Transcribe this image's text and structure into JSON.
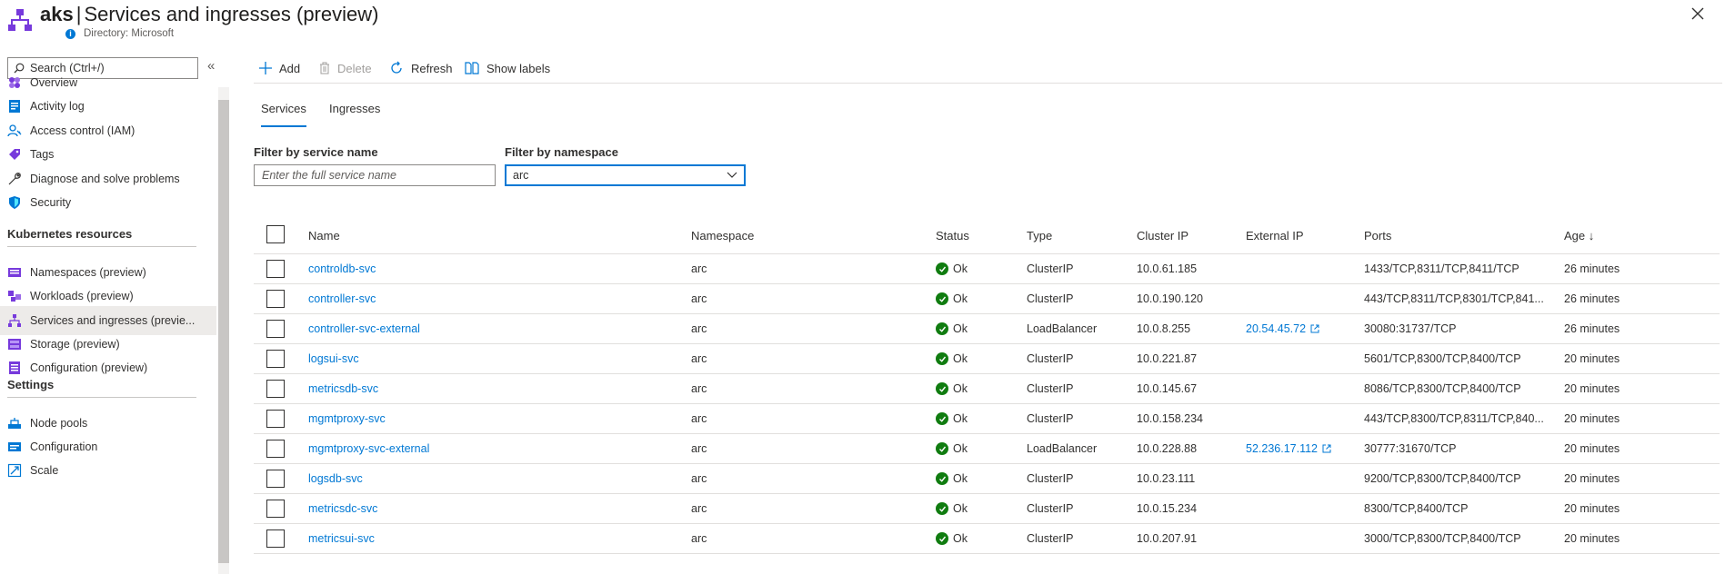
{
  "header": {
    "resource_name": "aks",
    "separator": "|",
    "page_title": "Services and ingresses (preview)",
    "directory": "Directory: Microsoft",
    "info_icon": "info-icon",
    "close_icon": "close-icon"
  },
  "sidebar": {
    "search_placeholder": "Search (Ctrl+/)",
    "collapse_glyph": "«",
    "items": [
      {
        "label": "Overview",
        "icon": "overview-icon"
      },
      {
        "label": "Activity log",
        "icon": "activity-log-icon"
      },
      {
        "label": "Access control (IAM)",
        "icon": "iam-icon"
      },
      {
        "label": "Tags",
        "icon": "tag-icon"
      },
      {
        "label": "Diagnose and solve problems",
        "icon": "wrench-icon"
      },
      {
        "label": "Security",
        "icon": "shield-icon"
      }
    ],
    "section_kubernetes": "Kubernetes resources",
    "k8s_items": [
      {
        "label": "Namespaces (preview)",
        "icon": "namespaces-icon"
      },
      {
        "label": "Workloads (preview)",
        "icon": "workloads-icon"
      },
      {
        "label": "Services and ingresses (previe...",
        "icon": "services-icon",
        "active": true
      },
      {
        "label": "Storage (preview)",
        "icon": "storage-icon"
      },
      {
        "label": "Configuration (preview)",
        "icon": "configuration-icon"
      }
    ],
    "section_settings": "Settings",
    "settings_items": [
      {
        "label": "Node pools",
        "icon": "node-pools-icon"
      },
      {
        "label": "Configuration",
        "icon": "configuration-icon"
      },
      {
        "label": "Scale",
        "icon": "scale-icon"
      }
    ]
  },
  "toolbar": {
    "add": "Add",
    "delete": "Delete",
    "refresh": "Refresh",
    "show_labels": "Show labels"
  },
  "tabs": {
    "services": "Services",
    "ingresses": "Ingresses"
  },
  "filters": {
    "service_name_label": "Filter by service name",
    "service_name_placeholder": "Enter the full service name",
    "namespace_label": "Filter by namespace",
    "namespace_value": "arc"
  },
  "table": {
    "columns": {
      "name": "Name",
      "namespace": "Namespace",
      "status": "Status",
      "type": "Type",
      "cluster_ip": "Cluster IP",
      "external_ip": "External IP",
      "ports": "Ports",
      "age": "Age ↓"
    },
    "rows": [
      {
        "name": "controldb-svc",
        "namespace": "arc",
        "status": "Ok",
        "type": "ClusterIP",
        "cluster_ip": "10.0.61.185",
        "external_ip": "",
        "ports": "1433/TCP,8311/TCP,8411/TCP",
        "age": "26 minutes"
      },
      {
        "name": "controller-svc",
        "namespace": "arc",
        "status": "Ok",
        "type": "ClusterIP",
        "cluster_ip": "10.0.190.120",
        "external_ip": "",
        "ports": "443/TCP,8311/TCP,8301/TCP,841...",
        "age": "26 minutes"
      },
      {
        "name": "controller-svc-external",
        "namespace": "arc",
        "status": "Ok",
        "type": "LoadBalancer",
        "cluster_ip": "10.0.8.255",
        "external_ip": "20.54.45.72",
        "ports": "30080:31737/TCP",
        "age": "26 minutes"
      },
      {
        "name": "logsui-svc",
        "namespace": "arc",
        "status": "Ok",
        "type": "ClusterIP",
        "cluster_ip": "10.0.221.87",
        "external_ip": "",
        "ports": "5601/TCP,8300/TCP,8400/TCP",
        "age": "20 minutes"
      },
      {
        "name": "metricsdb-svc",
        "namespace": "arc",
        "status": "Ok",
        "type": "ClusterIP",
        "cluster_ip": "10.0.145.67",
        "external_ip": "",
        "ports": "8086/TCP,8300/TCP,8400/TCP",
        "age": "20 minutes"
      },
      {
        "name": "mgmtproxy-svc",
        "namespace": "arc",
        "status": "Ok",
        "type": "ClusterIP",
        "cluster_ip": "10.0.158.234",
        "external_ip": "",
        "ports": "443/TCP,8300/TCP,8311/TCP,840...",
        "age": "20 minutes"
      },
      {
        "name": "mgmtproxy-svc-external",
        "namespace": "arc",
        "status": "Ok",
        "type": "LoadBalancer",
        "cluster_ip": "10.0.228.88",
        "external_ip": "52.236.17.112",
        "ports": "30777:31670/TCP",
        "age": "20 minutes"
      },
      {
        "name": "logsdb-svc",
        "namespace": "arc",
        "status": "Ok",
        "type": "ClusterIP",
        "cluster_ip": "10.0.23.111",
        "external_ip": "",
        "ports": "9200/TCP,8300/TCP,8400/TCP",
        "age": "20 minutes"
      },
      {
        "name": "metricsdc-svc",
        "namespace": "arc",
        "status": "Ok",
        "type": "ClusterIP",
        "cluster_ip": "10.0.15.234",
        "external_ip": "",
        "ports": "8300/TCP,8400/TCP",
        "age": "20 minutes"
      },
      {
        "name": "metricsui-svc",
        "namespace": "arc",
        "status": "Ok",
        "type": "ClusterIP",
        "cluster_ip": "10.0.207.91",
        "external_ip": "",
        "ports": "3000/TCP,8300/TCP,8400/TCP",
        "age": "20 minutes"
      }
    ]
  },
  "colors": {
    "accent": "#0078d4",
    "status_ok": "#107c10",
    "brand_purple": "#773adc"
  }
}
